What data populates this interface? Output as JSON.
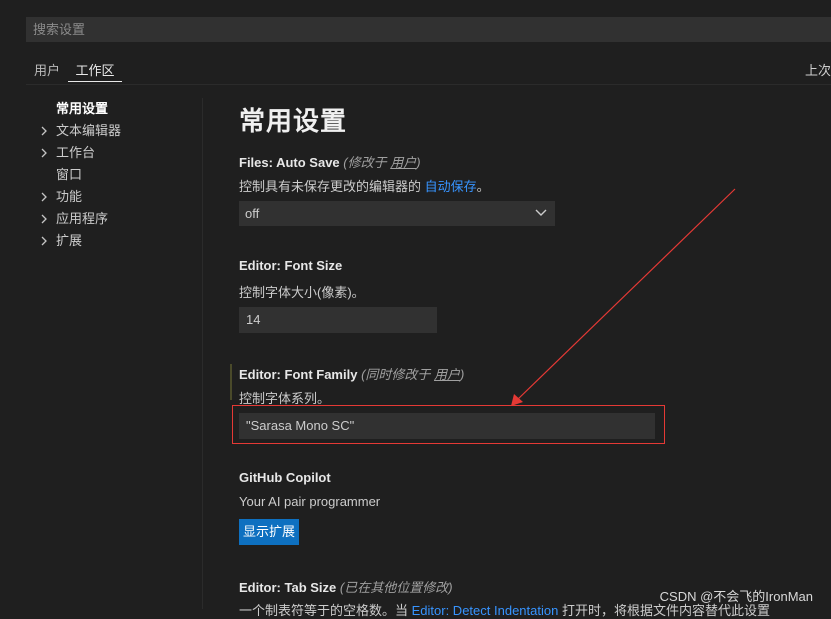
{
  "search": {
    "placeholder": "搜索设置"
  },
  "tabs": {
    "user": "用户",
    "workspace": "工作区",
    "right_text": "上次"
  },
  "toc": [
    {
      "label": "常用设置",
      "expandable": false,
      "active": true
    },
    {
      "label": "文本编辑器",
      "expandable": true
    },
    {
      "label": "工作台",
      "expandable": true
    },
    {
      "label": "窗口",
      "expandable": false
    },
    {
      "label": "功能",
      "expandable": true
    },
    {
      "label": "应用程序",
      "expandable": true
    },
    {
      "label": "扩展",
      "expandable": true
    }
  ],
  "page_title": "常用设置",
  "settings": {
    "auto_save": {
      "category": "Files: ",
      "name": "Auto Save",
      "note_prefix": " (修改于 ",
      "note_link": "用户",
      "note_suffix": ")",
      "desc_prefix": "控制具有未保存更改的编辑器的 ",
      "desc_link": "自动保存",
      "desc_suffix": "。",
      "value": "off"
    },
    "font_size": {
      "category": "Editor: ",
      "name": "Font Size",
      "desc": "控制字体大小(像素)。",
      "value": "14"
    },
    "font_family": {
      "category": "Editor: ",
      "name": "Font Family",
      "note_prefix": " (同时修改于 ",
      "note_link": "用户",
      "note_suffix": ")",
      "desc": "控制字体系列。",
      "value": "\"Sarasa Mono SC\""
    },
    "copilot": {
      "name": "GitHub Copilot",
      "desc": "Your AI pair programmer",
      "button": "显示扩展"
    },
    "tab_size": {
      "category": "Editor: ",
      "name": "Tab Size",
      "note": " (已在其他位置修改)",
      "desc_prefix": "一个制表符等于的空格数。当 ",
      "desc_link": "Editor: Detect Indentation",
      "desc_suffix": " 打开时，将根据文件内容替代此设置"
    }
  },
  "colors": {
    "accent_blue": "#0e70c0",
    "link": "#3794ff",
    "highlight_red": "#e53935"
  },
  "watermark": "CSDN @不会飞的IronMan"
}
